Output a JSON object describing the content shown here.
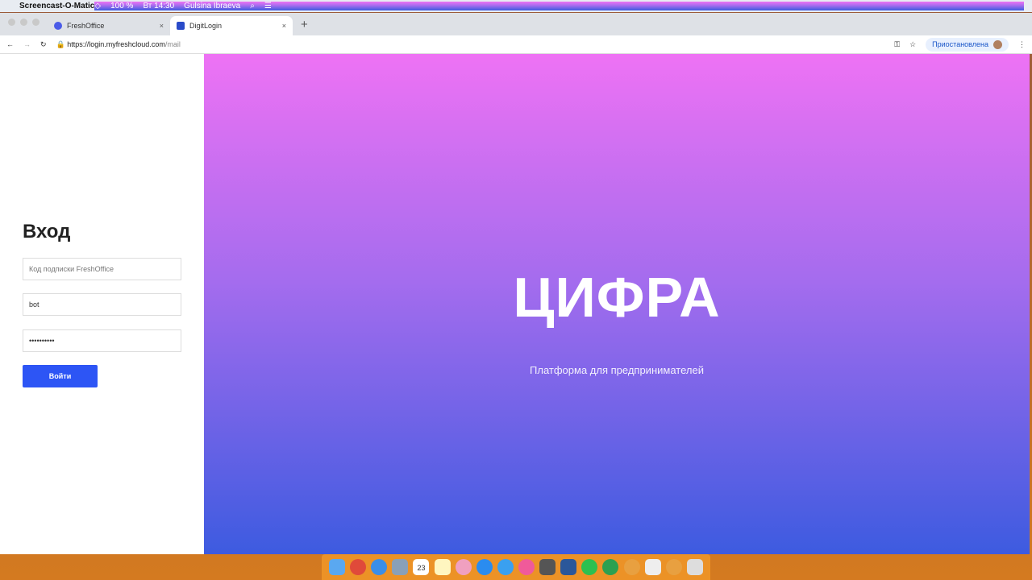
{
  "menubar": {
    "app": "Screencast-O-Matic",
    "battery": "100 %",
    "time": "Вт 14:30",
    "user": "Gulsina Ibraeva"
  },
  "tabs": [
    {
      "label": "FreshOffice"
    },
    {
      "label": "DigitLogin"
    }
  ],
  "address": {
    "host": "https://login.myfreshcloud.com",
    "path": "/mail"
  },
  "profile": {
    "label": "Приостановлена"
  },
  "login": {
    "title": "Вход",
    "subscription_placeholder": "Код подписки FreshOffice",
    "username": "bot",
    "password": "••••••••••",
    "submit": "Войти"
  },
  "hero": {
    "brand": "ЦИФРА",
    "tagline": "Платформа для предпринимателей"
  },
  "dock": {
    "apps": [
      "finder",
      "chrome",
      "safari",
      "preview",
      "calendar",
      "notes",
      "photos",
      "app-store",
      "messages",
      "music",
      "system-preferences",
      "word",
      "whatsapp",
      "app",
      "app",
      "document",
      "app",
      "trash"
    ],
    "calendar_day": "23"
  }
}
